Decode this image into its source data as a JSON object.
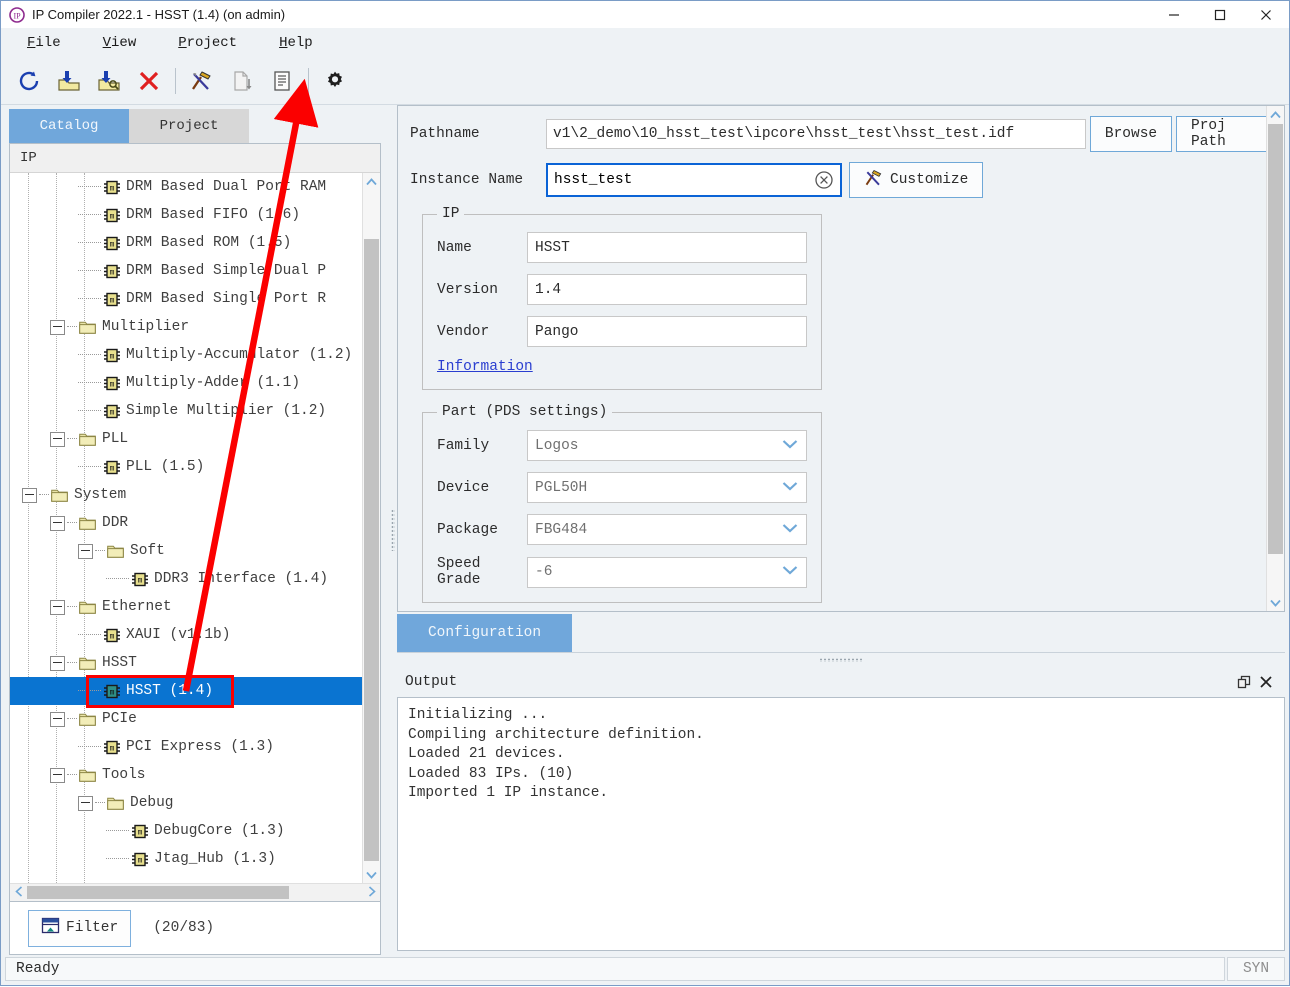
{
  "window": {
    "title": "IP Compiler 2022.1 - HSST (1.4) (on admin)",
    "app_icon": "ip-compiler-logo",
    "minimize": "—",
    "maximize": "☐",
    "close": "×"
  },
  "menubar": [
    {
      "label": "File",
      "mnemonic": "F"
    },
    {
      "label": "View",
      "mnemonic": "V"
    },
    {
      "label": "Project",
      "mnemonic": "P"
    },
    {
      "label": "Help",
      "mnemonic": "H"
    }
  ],
  "toolbar": [
    {
      "name": "refresh-icon",
      "tip": "Refresh"
    },
    {
      "name": "import-ip-icon",
      "tip": "Import IP"
    },
    {
      "name": "find-import-ip-icon",
      "tip": "Find and Import IP"
    },
    {
      "name": "delete-icon",
      "tip": "Delete"
    },
    {
      "name": "separator-1",
      "tip": ""
    },
    {
      "name": "customize-tools-icon",
      "tip": "Customize"
    },
    {
      "name": "generate-icon",
      "tip": "Generate"
    },
    {
      "name": "report-icon",
      "tip": "Report"
    },
    {
      "name": "separator-2",
      "tip": ""
    },
    {
      "name": "settings-gear-icon",
      "tip": "Settings"
    }
  ],
  "left": {
    "tabs": [
      {
        "label": "Catalog",
        "active": true
      },
      {
        "label": "Project",
        "active": false
      }
    ],
    "tree_header": "IP",
    "tree": [
      {
        "label": "DRM Based Dual Port RAM",
        "kind": "ip",
        "indent": 3,
        "selected": false
      },
      {
        "label": "DRM Based FIFO (1.6)",
        "kind": "ip",
        "indent": 3,
        "selected": false
      },
      {
        "label": "DRM Based ROM (1.5)",
        "kind": "ip",
        "indent": 3,
        "selected": false
      },
      {
        "label": "DRM Based Simple Dual P",
        "kind": "ip",
        "indent": 3,
        "selected": false
      },
      {
        "label": "DRM Based Single Port R",
        "kind": "ip",
        "indent": 3,
        "selected": false
      },
      {
        "label": "Multiplier",
        "kind": "folder",
        "indent": 2,
        "selected": false
      },
      {
        "label": "Multiply-Accumulator (1.2)",
        "kind": "ip",
        "indent": 3,
        "selected": false
      },
      {
        "label": "Multiply-Adder (1.1)",
        "kind": "ip",
        "indent": 3,
        "selected": false
      },
      {
        "label": "Simple Multiplier (1.2)",
        "kind": "ip",
        "indent": 3,
        "selected": false
      },
      {
        "label": "PLL",
        "kind": "folder",
        "indent": 2,
        "selected": false
      },
      {
        "label": "PLL (1.5)",
        "kind": "ip",
        "indent": 3,
        "selected": false
      },
      {
        "label": "System",
        "kind": "folder",
        "indent": 1,
        "selected": false
      },
      {
        "label": "DDR",
        "kind": "folder",
        "indent": 2,
        "selected": false
      },
      {
        "label": "Soft",
        "kind": "folder",
        "indent": 3,
        "selected": false
      },
      {
        "label": "DDR3 Interface (1.4)",
        "kind": "ip",
        "indent": 4,
        "selected": false
      },
      {
        "label": "Ethernet",
        "kind": "folder",
        "indent": 2,
        "selected": false
      },
      {
        "label": "XAUI (v1.1b)",
        "kind": "ip",
        "indent": 3,
        "selected": false
      },
      {
        "label": "HSST",
        "kind": "folder",
        "indent": 2,
        "selected": false
      },
      {
        "label": "HSST (1.4)",
        "kind": "ip",
        "indent": 3,
        "selected": true
      },
      {
        "label": "PCIe",
        "kind": "folder",
        "indent": 2,
        "selected": false
      },
      {
        "label": "PCI Express (1.3)",
        "kind": "ip",
        "indent": 3,
        "selected": false
      },
      {
        "label": "Tools",
        "kind": "folder",
        "indent": 2,
        "selected": false
      },
      {
        "label": "Debug",
        "kind": "folder",
        "indent": 3,
        "selected": false
      },
      {
        "label": "DebugCore (1.3)",
        "kind": "ip",
        "indent": 4,
        "selected": false
      },
      {
        "label": "Jtag_Hub (1.3)",
        "kind": "ip",
        "indent": 4,
        "selected": false
      }
    ],
    "filter_button": "Filter",
    "filter_count": "(20/83)"
  },
  "config": {
    "pathname_label": "Pathname",
    "pathname_value": "v1\\2_demo\\10_hsst_test\\ipcore\\hsst_test\\hsst_test.idf",
    "browse_label": "Browse",
    "proj_path_label": "Proj Path",
    "instance_label": "Instance Name",
    "instance_value": "hsst_test",
    "clear_icon": "clear-circle-x-icon",
    "customize_label": "Customize",
    "ip_group": {
      "legend": "IP",
      "fields": [
        {
          "label": "Name",
          "value": "HSST"
        },
        {
          "label": "Version",
          "value": "1.4"
        },
        {
          "label": "Vendor",
          "value": "Pango"
        }
      ],
      "information_link": "Information"
    },
    "part_group": {
      "legend": "Part (PDS settings)",
      "fields": [
        {
          "label": "Family",
          "value": "Logos"
        },
        {
          "label": "Device",
          "value": "PGL50H"
        },
        {
          "label": "Package",
          "value": "FBG484"
        },
        {
          "label": "Speed Grade",
          "value": "-6"
        }
      ]
    },
    "tab_label": "Configuration"
  },
  "output": {
    "title": "Output",
    "undock_icon": "undock-icon",
    "close_icon": "close-icon",
    "lines": [
      "Initializing ...",
      "Compiling architecture definition.",
      "Loaded 21 devices.",
      "Loaded 83 IPs. (10)",
      "Imported 1 IP instance."
    ]
  },
  "statusbar": {
    "message": "Ready",
    "right_cell": "SYN"
  },
  "annotation": {
    "arrow_color": "#fb0000",
    "highlight_color": "#fb0000",
    "arrow_from": "hsst-tree-item",
    "arrow_to": "report-toolbar-icon"
  },
  "colors": {
    "accent_tab": "#70a7db",
    "selection": "#0a74d1",
    "window_bg": "#eef2f5",
    "link": "#2a3ed0"
  }
}
